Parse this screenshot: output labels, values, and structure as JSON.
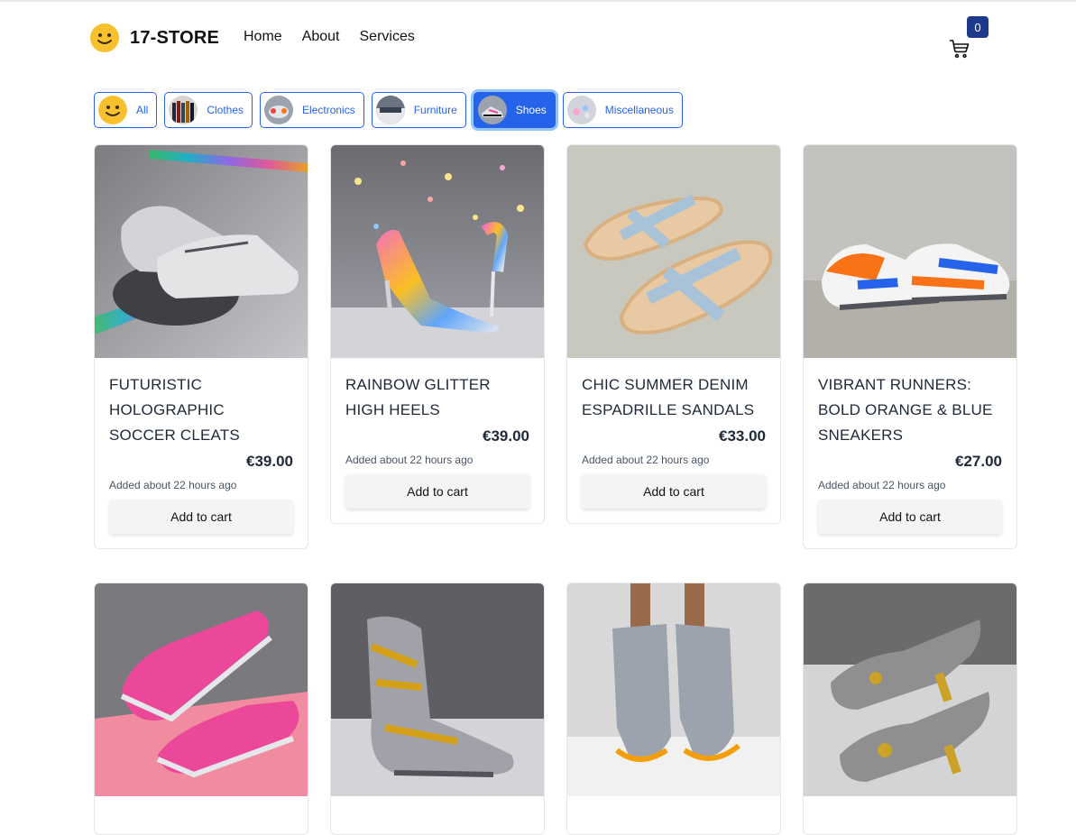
{
  "header": {
    "brand": "17-STORE",
    "nav": [
      "Home",
      "About",
      "Services"
    ],
    "cart_count": "0"
  },
  "categories": [
    {
      "label": "All",
      "icon": "smiley-icon",
      "active": false
    },
    {
      "label": "Clothes",
      "icon": "clothes-thumbnail",
      "active": false
    },
    {
      "label": "Electronics",
      "icon": "electronics-thumbnail",
      "active": false
    },
    {
      "label": "Furniture",
      "icon": "furniture-thumbnail",
      "active": false
    },
    {
      "label": "Shoes",
      "icon": "shoes-thumbnail",
      "active": true
    },
    {
      "label": "Miscellaneous",
      "icon": "miscellaneous-thumbnail",
      "active": false
    }
  ],
  "products": [
    {
      "title": "FUTURISTIC HOLOGRAPHIC SOCCER CLEATS",
      "price": "€39.00",
      "added": "Added about 22 hours ago",
      "cta": "Add to cart"
    },
    {
      "title": "RAINBOW GLITTER HIGH HEELS",
      "price": "€39.00",
      "added": "Added about 22 hours ago",
      "cta": "Add to cart"
    },
    {
      "title": "CHIC SUMMER DENIM ESPADRILLE SANDALS",
      "price": "€33.00",
      "added": "Added about 22 hours ago",
      "cta": "Add to cart"
    },
    {
      "title": "VIBRANT RUNNERS: BOLD ORANGE & BLUE SNEAKERS",
      "price": "€27.00",
      "added": "Added about 22 hours ago",
      "cta": "Add to cart"
    }
  ],
  "colors": {
    "accent": "#2563eb",
    "badge": "#1e3a8a",
    "button_bg": "#f3f4f6"
  }
}
